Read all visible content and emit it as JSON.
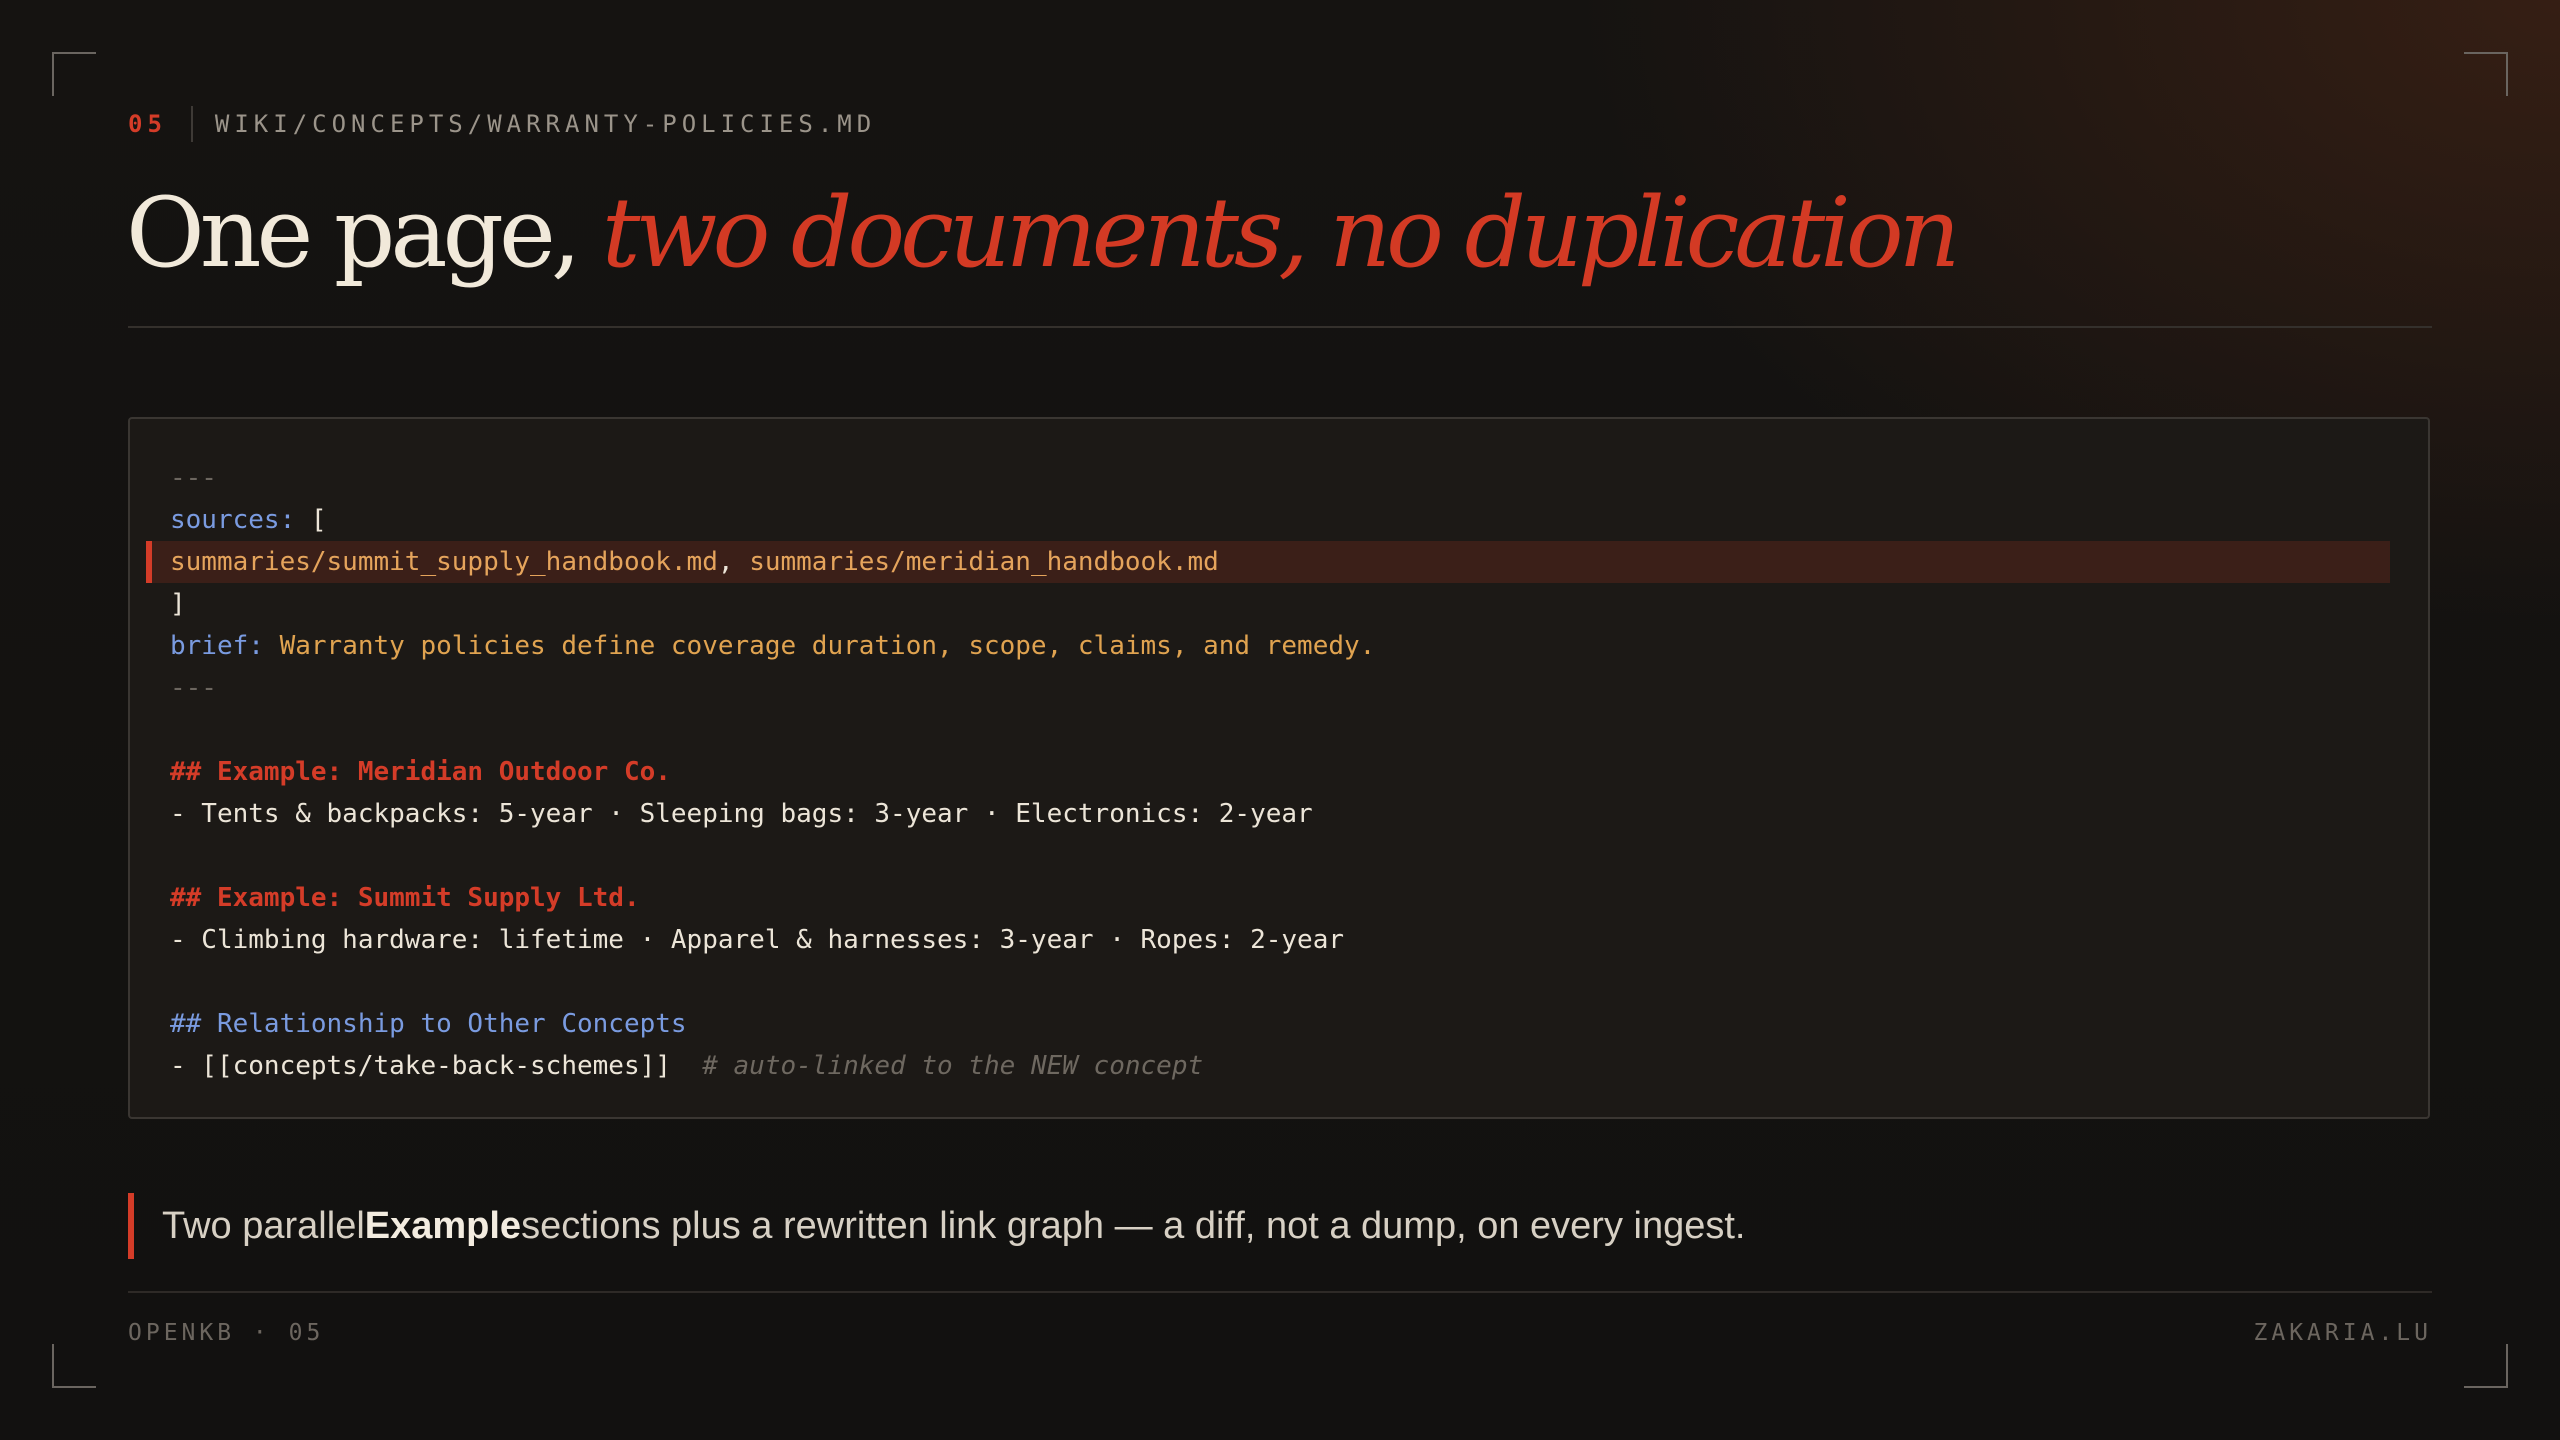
{
  "slide": {
    "number": "05",
    "path": "WIKI/CONCEPTS/WARRANTY-POLICIES.MD"
  },
  "title": {
    "plain": "One page, ",
    "accent": "two documents, no duplication"
  },
  "code": {
    "frontmatter_open": "---",
    "sources_key": "sources:",
    "sources_open": " [",
    "source_1": "summaries/summit_supply_handbook.md",
    "source_sep": ", ",
    "source_2": "summaries/meridian_handbook.md",
    "sources_close": "]",
    "brief_key": "brief:",
    "brief_value": " Warranty policies define coverage duration, scope, claims, and remedy.",
    "frontmatter_close": "---",
    "section_1_heading": "## Example: Meridian Outdoor Co.",
    "section_1_body": "- Tents & backpacks: 5-year · Sleeping bags: 3-year · Electronics: 2-year",
    "section_2_heading": "## Example: Summit Supply Ltd.",
    "section_2_body": "- Climbing hardware: lifetime · Apparel & harnesses: 3-year · Ropes: 2-year",
    "section_3_heading": "## Relationship to Other Concepts",
    "section_3_link": "- [[concepts/take-back-schemes]]",
    "section_3_comment": "# auto-linked to the NEW concept"
  },
  "callout": {
    "before": "Two parallel ",
    "bold": "Example",
    "after": " sections plus a rewritten link graph — a diff, not a dump, on every ingest."
  },
  "footer": {
    "left": "OPENKB · 05",
    "right": "ZAKARIA.LU"
  },
  "colors": {
    "accent": "#d43c28",
    "key_blue": "#7a9be0",
    "value_orange": "#e0a350",
    "background": "#141312"
  }
}
